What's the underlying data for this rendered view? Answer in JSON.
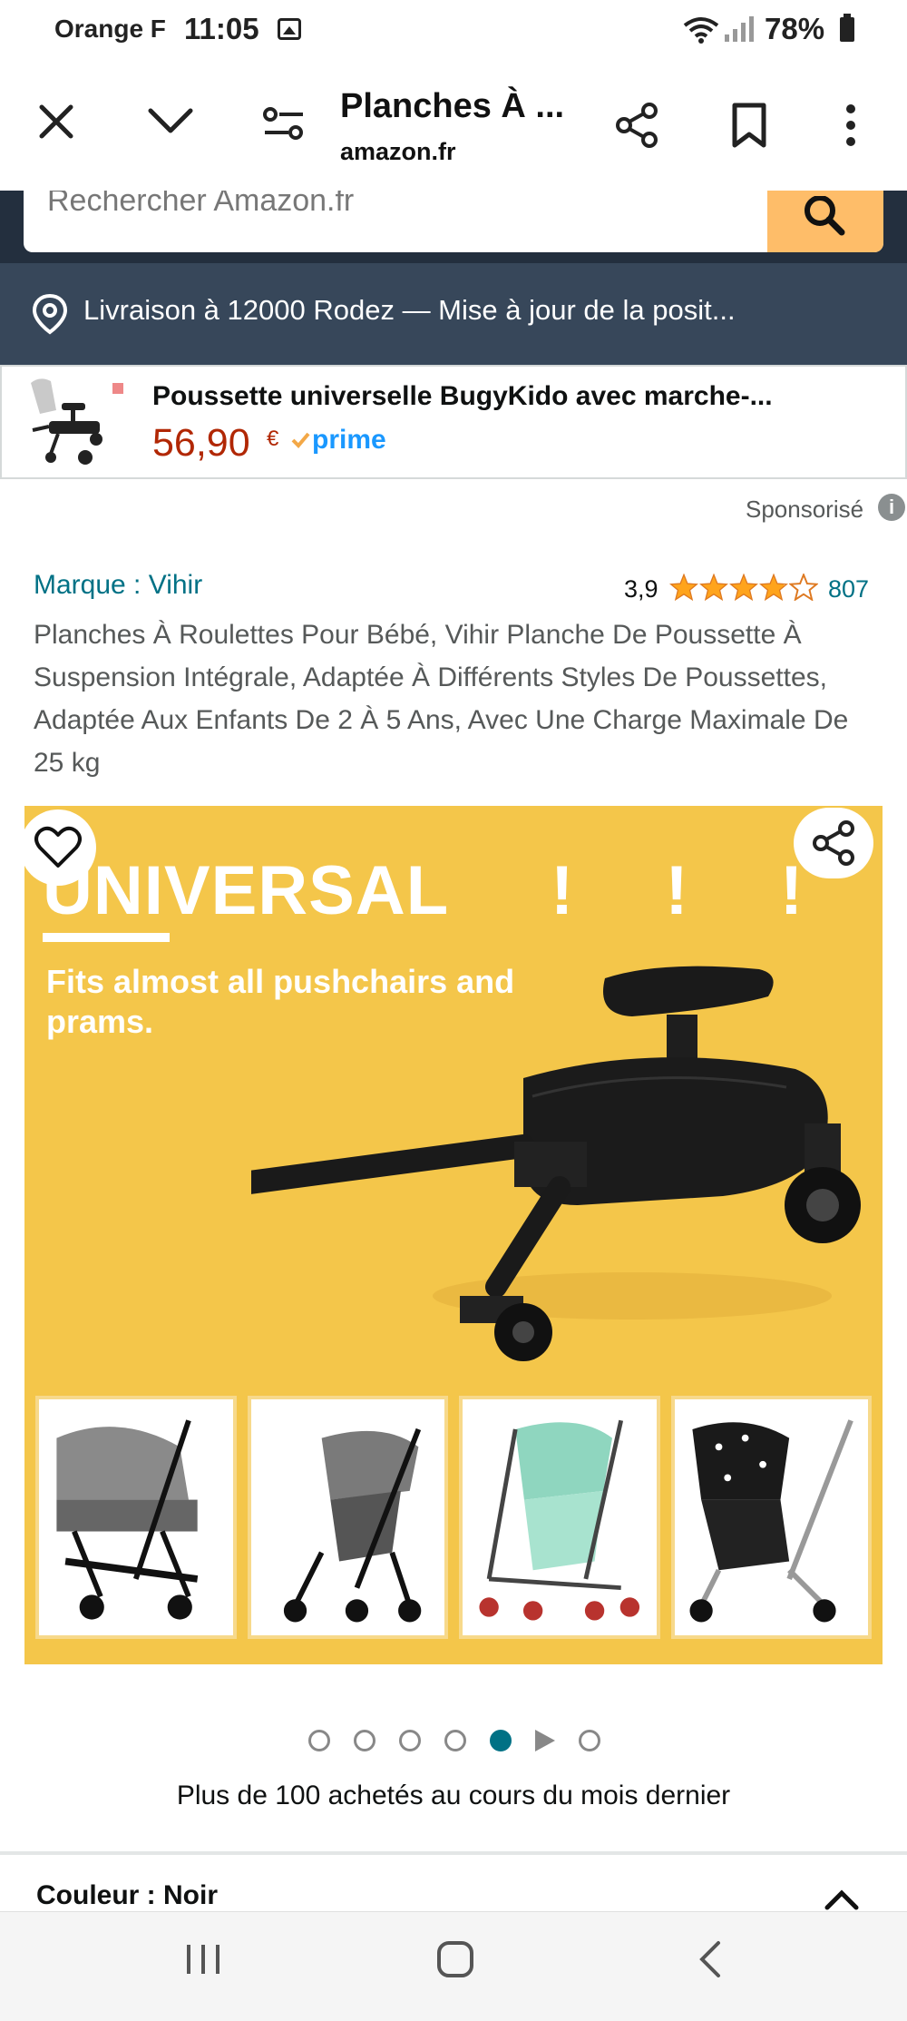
{
  "status_bar": {
    "carrier": "Orange F",
    "time": "11:05",
    "battery": "78%"
  },
  "browser": {
    "title": "Planches À ...",
    "url": "amazon.fr"
  },
  "search": {
    "placeholder": "Rechercher Amazon.fr"
  },
  "delivery": {
    "text": "Livraison à 12000 Rodez — Mise à jour de la posit..."
  },
  "sponsored_ad": {
    "title": "Poussette universelle BugyKido avec marche-...",
    "price": "56,90",
    "currency": "€",
    "prime": "prime",
    "sponsored_label": "Sponsorisé",
    "info_glyph": "i"
  },
  "product": {
    "brand": "Marque : Vihir",
    "rating": "3,9",
    "rating_value": 3.9,
    "rating_count": "807",
    "title": "Planches À Roulettes Pour Bébé, Vihir Planche De Poussette À Suspension Intégrale, Adaptée À Différents Styles De Poussettes, Adaptée Aux Enfants De 2 À 5 Ans, Avec Une Charge Maximale De 25 kg"
  },
  "hero_image": {
    "headline": "UNIVERSAL",
    "exclaims": "! ! !",
    "subtitle": "Fits almost all pushchairs and prams.",
    "thumbnails": [
      {
        "name": "pram-grey"
      },
      {
        "name": "stroller-grey"
      },
      {
        "name": "stroller-mint"
      },
      {
        "name": "stroller-black-pattern"
      }
    ]
  },
  "carousel": {
    "total_dots": 7,
    "active_index": 4,
    "video_index": 5
  },
  "social_proof": {
    "text": "Plus de 100 achetés au cours du mois dernier"
  },
  "next_section": {
    "label": "Couleur : Noir"
  },
  "colors": {
    "amazon_dark": "#232f3e",
    "amazon_slate": "#37475a",
    "search_button": "#febd69",
    "link_teal": "#007185",
    "price_red": "#b12704",
    "star_orange": "#ffa41c",
    "hero_yellow": "#f4c64a"
  },
  "icons": [
    "close-icon",
    "chevron-down-icon",
    "page-settings-icon",
    "share-icon",
    "bookmark-icon",
    "more-vert-icon",
    "search-icon",
    "location-pin-icon",
    "heart-icon",
    "chevron-up-icon",
    "recents-icon",
    "home-icon",
    "back-icon"
  ]
}
